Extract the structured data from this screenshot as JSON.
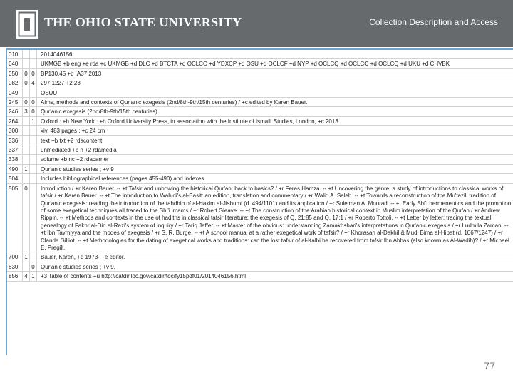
{
  "header": {
    "logo_letter": "O",
    "university_name": "THE OHIO STATE UNIVERSITY",
    "section_title": "Collection Description and Access"
  },
  "marc_record": {
    "rows": [
      {
        "tag": "010",
        "ind1": "",
        "ind2": "",
        "value": "2014046156"
      },
      {
        "tag": "040",
        "ind1": "",
        "ind2": "",
        "value": "UKMGB +b eng +e rda +c UKMGB +d DLC +d BTCTA +d OCLCO +d YDXCP +d OSU +d OCLCF +d NYP +d OCLCQ +d OCLCO +d OCLCQ +d UKU +d CHVBK"
      },
      {
        "tag": "050",
        "ind1": "0",
        "ind2": "0",
        "value": "BP130.45 +b .A37 2013"
      },
      {
        "tag": "082",
        "ind1": "0",
        "ind2": "4",
        "value": "297.1227 +2 23"
      },
      {
        "tag": "049",
        "ind1": "",
        "ind2": "",
        "value": "OSUU"
      },
      {
        "tag": "245",
        "ind1": "0",
        "ind2": "0",
        "value": "Aims, methods and contexts of Qur'anic exegesis (2nd/8th-9th/15th centuries) / +c edited by Karen Bauer."
      },
      {
        "tag": "246",
        "ind1": "3",
        "ind2": "0",
        "value": "Qur'anic exegesis (2nd/8th-9th/15th centuries)"
      },
      {
        "tag": "264",
        "ind1": "",
        "ind2": "1",
        "value": "Oxford : +b New York : +b Oxford University Press, in association with the Institute of Ismaili Studies, London, +c 2013."
      },
      {
        "tag": "300",
        "ind1": "",
        "ind2": "",
        "value": "xiv, 483 pages ; +c 24 cm"
      },
      {
        "tag": "336",
        "ind1": "",
        "ind2": "",
        "value": "text +b txt +2 rdacontent"
      },
      {
        "tag": "337",
        "ind1": "",
        "ind2": "",
        "value": "unmediated +b n +2 rdamedia"
      },
      {
        "tag": "338",
        "ind1": "",
        "ind2": "",
        "value": "volume +b nc +2 rdacarrier"
      },
      {
        "tag": "490",
        "ind1": "1",
        "ind2": "",
        "value": "Qur'anic studies series ; +v 9"
      },
      {
        "tag": "504",
        "ind1": "",
        "ind2": "",
        "value": "Includes bibliographical references (pages 455-490) and indexes."
      },
      {
        "tag": "505",
        "ind1": "0",
        "ind2": "",
        "value": "Introduction / +r Karen Bauer. -- +t Tafsir and unbowing the historical Qur'an: back to basics? / +r Feras Hamza. -- +t Uncovering the genre: a study of introductions to classical works of tafsir / +r Karen Bauer. -- +t The introduction to Wahidi's al-Basit: an edition, translation and commentary / +r Walid A. Saleh. -- +t Towards a reconstruction of the Mu'tazili tradition of Qur'anic exegesis: reading the introduction of the tahdhib of al-Hakim al-Jishumi (d. 494/1101) and its application / +r Suleiman A. Mourad. -- +t Early Shi'i hermeneutics and the promotion of some exegetical techniques all traced to the Shi'i imams / +r Robert Gleave. -- +t The construction of the Arabian historical context in Muslim interpretation of the Qur'an / +r Andrew Rippin. -- +t Methods and contexts in the use of hadiths in classical tafsir literature: the exegesis of Q. 21:85 and Q. 17:1 / +r Roberto Tottoli. -- +t Letter by letter: tracing the textual genealogy of Fakhr al-Din al-Razi's system of inquiry / +r Tariq Jaffer. -- +t Master of the obvious: understanding Zamakhshari's interpretations in Qur'anic exegesis / +r Ludmila Zaman. -- +t Ibn Taymiyya and the modes of exegesis / +r S. R. Burge. -- +t A school manual at a rather exegetical work of tafsir? / +r Khorasan al-Dakhil & Mudi Bima al-Hibat (d. 1067/1247) / +r Claude Gilliot. -- +t Methodologies for the dating of exegetical works and traditions: can the lost tafsir of al-Kalbi be recovered from tafsir Ibn Abbas (also known as Al-Wadih)? / +r Michael E. Pregill."
      },
      {
        "tag": "700",
        "ind1": "1",
        "ind2": "",
        "value": "Bauer, Karen, +d 1973- +e editor."
      },
      {
        "tag": "830",
        "ind1": "",
        "ind2": "0",
        "value": "Qur'anic studies series ; +v 9."
      },
      {
        "tag": "856",
        "ind1": "4",
        "ind2": "1",
        "value": "+3 Table of contents +u http://catdir.loc.gov/catdir/toc/fy15pdf01/2014046156.html"
      }
    ]
  },
  "footer": {
    "page_number": "77"
  },
  "colors": {
    "header_bg": "#666a6d",
    "table_border_accent": "#6ea2cf",
    "osu_scarlet": "#bb0000"
  }
}
